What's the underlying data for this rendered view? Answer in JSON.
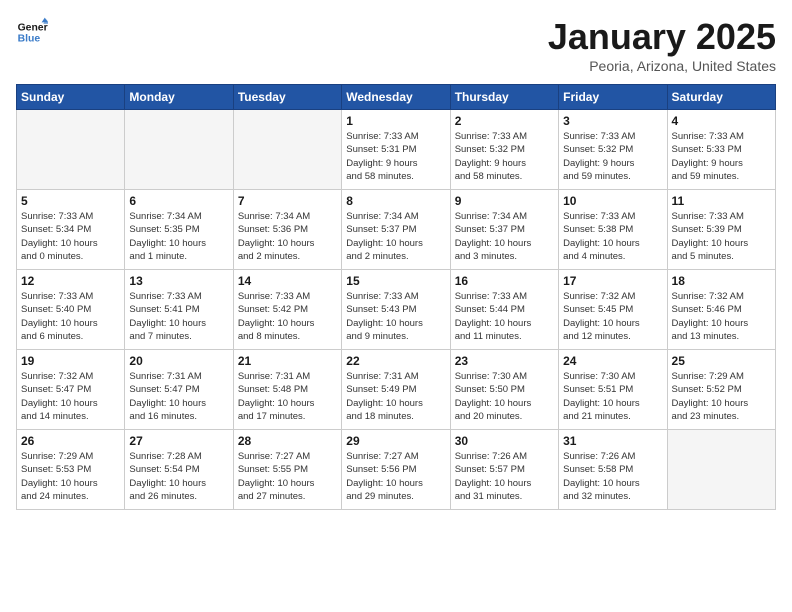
{
  "logo": {
    "line1": "General",
    "line2": "Blue"
  },
  "title": "January 2025",
  "subtitle": "Peoria, Arizona, United States",
  "days_of_week": [
    "Sunday",
    "Monday",
    "Tuesday",
    "Wednesday",
    "Thursday",
    "Friday",
    "Saturday"
  ],
  "weeks": [
    [
      {
        "day": "",
        "info": "",
        "empty": true
      },
      {
        "day": "",
        "info": "",
        "empty": true
      },
      {
        "day": "",
        "info": "",
        "empty": true
      },
      {
        "day": "1",
        "info": "Sunrise: 7:33 AM\nSunset: 5:31 PM\nDaylight: 9 hours\nand 58 minutes."
      },
      {
        "day": "2",
        "info": "Sunrise: 7:33 AM\nSunset: 5:32 PM\nDaylight: 9 hours\nand 58 minutes."
      },
      {
        "day": "3",
        "info": "Sunrise: 7:33 AM\nSunset: 5:32 PM\nDaylight: 9 hours\nand 59 minutes."
      },
      {
        "day": "4",
        "info": "Sunrise: 7:33 AM\nSunset: 5:33 PM\nDaylight: 9 hours\nand 59 minutes."
      }
    ],
    [
      {
        "day": "5",
        "info": "Sunrise: 7:33 AM\nSunset: 5:34 PM\nDaylight: 10 hours\nand 0 minutes."
      },
      {
        "day": "6",
        "info": "Sunrise: 7:34 AM\nSunset: 5:35 PM\nDaylight: 10 hours\nand 1 minute."
      },
      {
        "day": "7",
        "info": "Sunrise: 7:34 AM\nSunset: 5:36 PM\nDaylight: 10 hours\nand 2 minutes."
      },
      {
        "day": "8",
        "info": "Sunrise: 7:34 AM\nSunset: 5:37 PM\nDaylight: 10 hours\nand 2 minutes."
      },
      {
        "day": "9",
        "info": "Sunrise: 7:34 AM\nSunset: 5:37 PM\nDaylight: 10 hours\nand 3 minutes."
      },
      {
        "day": "10",
        "info": "Sunrise: 7:33 AM\nSunset: 5:38 PM\nDaylight: 10 hours\nand 4 minutes."
      },
      {
        "day": "11",
        "info": "Sunrise: 7:33 AM\nSunset: 5:39 PM\nDaylight: 10 hours\nand 5 minutes."
      }
    ],
    [
      {
        "day": "12",
        "info": "Sunrise: 7:33 AM\nSunset: 5:40 PM\nDaylight: 10 hours\nand 6 minutes."
      },
      {
        "day": "13",
        "info": "Sunrise: 7:33 AM\nSunset: 5:41 PM\nDaylight: 10 hours\nand 7 minutes."
      },
      {
        "day": "14",
        "info": "Sunrise: 7:33 AM\nSunset: 5:42 PM\nDaylight: 10 hours\nand 8 minutes."
      },
      {
        "day": "15",
        "info": "Sunrise: 7:33 AM\nSunset: 5:43 PM\nDaylight: 10 hours\nand 9 minutes."
      },
      {
        "day": "16",
        "info": "Sunrise: 7:33 AM\nSunset: 5:44 PM\nDaylight: 10 hours\nand 11 minutes."
      },
      {
        "day": "17",
        "info": "Sunrise: 7:32 AM\nSunset: 5:45 PM\nDaylight: 10 hours\nand 12 minutes."
      },
      {
        "day": "18",
        "info": "Sunrise: 7:32 AM\nSunset: 5:46 PM\nDaylight: 10 hours\nand 13 minutes."
      }
    ],
    [
      {
        "day": "19",
        "info": "Sunrise: 7:32 AM\nSunset: 5:47 PM\nDaylight: 10 hours\nand 14 minutes."
      },
      {
        "day": "20",
        "info": "Sunrise: 7:31 AM\nSunset: 5:47 PM\nDaylight: 10 hours\nand 16 minutes."
      },
      {
        "day": "21",
        "info": "Sunrise: 7:31 AM\nSunset: 5:48 PM\nDaylight: 10 hours\nand 17 minutes."
      },
      {
        "day": "22",
        "info": "Sunrise: 7:31 AM\nSunset: 5:49 PM\nDaylight: 10 hours\nand 18 minutes."
      },
      {
        "day": "23",
        "info": "Sunrise: 7:30 AM\nSunset: 5:50 PM\nDaylight: 10 hours\nand 20 minutes."
      },
      {
        "day": "24",
        "info": "Sunrise: 7:30 AM\nSunset: 5:51 PM\nDaylight: 10 hours\nand 21 minutes."
      },
      {
        "day": "25",
        "info": "Sunrise: 7:29 AM\nSunset: 5:52 PM\nDaylight: 10 hours\nand 23 minutes."
      }
    ],
    [
      {
        "day": "26",
        "info": "Sunrise: 7:29 AM\nSunset: 5:53 PM\nDaylight: 10 hours\nand 24 minutes."
      },
      {
        "day": "27",
        "info": "Sunrise: 7:28 AM\nSunset: 5:54 PM\nDaylight: 10 hours\nand 26 minutes."
      },
      {
        "day": "28",
        "info": "Sunrise: 7:27 AM\nSunset: 5:55 PM\nDaylight: 10 hours\nand 27 minutes."
      },
      {
        "day": "29",
        "info": "Sunrise: 7:27 AM\nSunset: 5:56 PM\nDaylight: 10 hours\nand 29 minutes."
      },
      {
        "day": "30",
        "info": "Sunrise: 7:26 AM\nSunset: 5:57 PM\nDaylight: 10 hours\nand 31 minutes."
      },
      {
        "day": "31",
        "info": "Sunrise: 7:26 AM\nSunset: 5:58 PM\nDaylight: 10 hours\nand 32 minutes."
      },
      {
        "day": "",
        "info": "",
        "empty": true
      }
    ]
  ]
}
